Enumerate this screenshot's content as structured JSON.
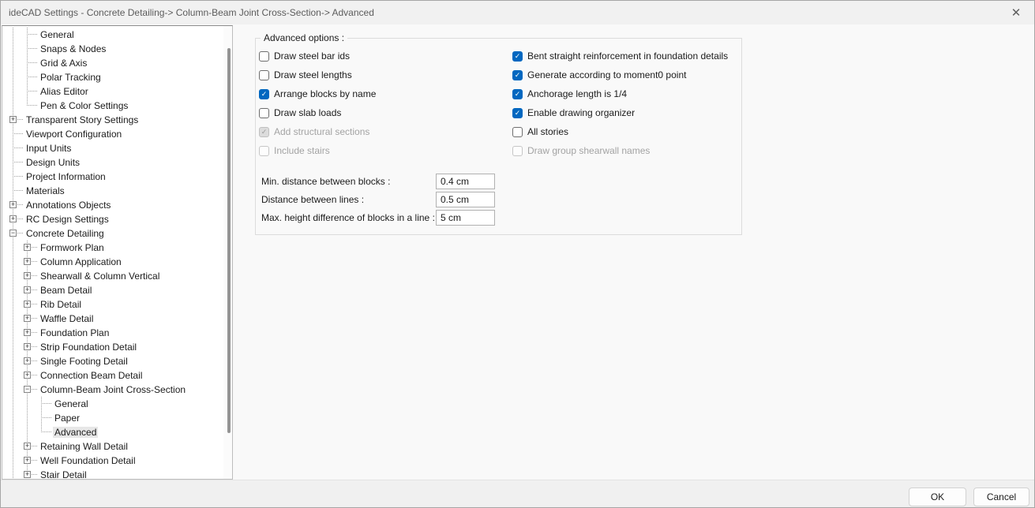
{
  "window": {
    "title": "ideCAD Settings - Concrete Detailing-> Column-Beam Joint Cross-Section-> Advanced",
    "close_icon": "✕"
  },
  "tree": {
    "items": [
      {
        "label": "General",
        "level": 2,
        "toggle": "none"
      },
      {
        "label": "Snaps & Nodes",
        "level": 2,
        "toggle": "none"
      },
      {
        "label": "Grid & Axis",
        "level": 2,
        "toggle": "none"
      },
      {
        "label": "Polar Tracking",
        "level": 2,
        "toggle": "none"
      },
      {
        "label": "Alias Editor",
        "level": 2,
        "toggle": "none"
      },
      {
        "label": "Pen & Color Settings",
        "level": 2,
        "toggle": "none",
        "last": true
      },
      {
        "label": "Transparent Story Settings",
        "level": 1,
        "toggle": "plus"
      },
      {
        "label": "Viewport Configuration",
        "level": 1,
        "toggle": "none"
      },
      {
        "label": "Input Units",
        "level": 1,
        "toggle": "none"
      },
      {
        "label": "Design Units",
        "level": 1,
        "toggle": "none"
      },
      {
        "label": "Project Information",
        "level": 1,
        "toggle": "none"
      },
      {
        "label": "Materials",
        "level": 1,
        "toggle": "none"
      },
      {
        "label": "Annotations Objects",
        "level": 1,
        "toggle": "plus"
      },
      {
        "label": "RC Design Settings",
        "level": 1,
        "toggle": "plus"
      },
      {
        "label": "Concrete Detailing",
        "level": 1,
        "toggle": "minus"
      },
      {
        "label": "Formwork Plan",
        "level": 2,
        "toggle": "plus"
      },
      {
        "label": "Column Application",
        "level": 2,
        "toggle": "plus"
      },
      {
        "label": "Shearwall & Column Vertical",
        "level": 2,
        "toggle": "plus"
      },
      {
        "label": "Beam Detail",
        "level": 2,
        "toggle": "plus"
      },
      {
        "label": "Rib Detail",
        "level": 2,
        "toggle": "plus"
      },
      {
        "label": "Waffle Detail",
        "level": 2,
        "toggle": "plus"
      },
      {
        "label": "Foundation Plan",
        "level": 2,
        "toggle": "plus"
      },
      {
        "label": "Strip Foundation Detail",
        "level": 2,
        "toggle": "plus"
      },
      {
        "label": "Single Footing Detail",
        "level": 2,
        "toggle": "plus"
      },
      {
        "label": "Connection Beam Detail",
        "level": 2,
        "toggle": "plus"
      },
      {
        "label": "Column-Beam Joint Cross-Section",
        "level": 2,
        "toggle": "minus"
      },
      {
        "label": "General",
        "level": 3,
        "toggle": "none"
      },
      {
        "label": "Paper",
        "level": 3,
        "toggle": "none"
      },
      {
        "label": "Advanced",
        "level": 3,
        "toggle": "none",
        "selected": true,
        "last": true
      },
      {
        "label": "Retaining Wall Detail",
        "level": 2,
        "toggle": "plus"
      },
      {
        "label": "Well Foundation Detail",
        "level": 2,
        "toggle": "plus"
      },
      {
        "label": "Stair Detail",
        "level": 2,
        "toggle": "plus"
      }
    ]
  },
  "advanced": {
    "group_title": "Advanced options :",
    "checkboxes_left": [
      {
        "label": "Draw steel bar ids",
        "checked": false,
        "disabled": false
      },
      {
        "label": "Draw steel lengths",
        "checked": false,
        "disabled": false
      },
      {
        "label": "Arrange blocks by name",
        "checked": true,
        "disabled": false
      },
      {
        "label": "Draw slab loads",
        "checked": false,
        "disabled": false
      },
      {
        "label": "Add structural sections",
        "checked": true,
        "disabled": true
      },
      {
        "label": "Include stairs",
        "checked": false,
        "disabled": true
      }
    ],
    "checkboxes_right": [
      {
        "label": "Bent straight reinforcement in foundation details",
        "checked": true,
        "disabled": false
      },
      {
        "label": "Generate according to moment0 point",
        "checked": true,
        "disabled": false
      },
      {
        "label": "Anchorage length is 1/4",
        "checked": true,
        "disabled": false
      },
      {
        "label": "Enable drawing organizer",
        "checked": true,
        "disabled": false
      },
      {
        "label": "All stories",
        "checked": false,
        "disabled": false
      },
      {
        "label": "Draw group shearwall names",
        "checked": false,
        "disabled": true
      }
    ],
    "fields": [
      {
        "label": "Min. distance between blocks :",
        "value": "0.4 cm"
      },
      {
        "label": "Distance between lines :",
        "value": "0.5 cm"
      },
      {
        "label": "Max. height difference of blocks in a line :",
        "value": "5 cm"
      }
    ]
  },
  "footer": {
    "ok_label": "OK",
    "cancel_label": "Cancel"
  },
  "colors": {
    "accent": "#0067c0",
    "titlebar_bg": "#f1f1f1",
    "body_bg": "#f9f9f9",
    "footer_bg": "#f0f0f0",
    "selection_bg": "#e7e7e7",
    "check_glyph": "✓"
  }
}
